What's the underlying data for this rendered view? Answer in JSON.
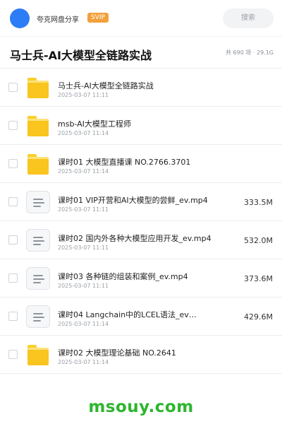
{
  "header": {
    "brand": "夸克网盘分享",
    "badge": "SVIP",
    "search_label": "搜索"
  },
  "folder": {
    "title": "马士兵-AI大模型全链路实战",
    "summary": "共 690 项 · 29.1G"
  },
  "files": [
    {
      "name": "马士兵-AI大模型全链路实战",
      "date": "2025-03-07 11:11",
      "type": "folder",
      "size": ""
    },
    {
      "name": "msb-AI大模型工程师",
      "date": "2025-03-07 11:14",
      "type": "folder",
      "size": ""
    },
    {
      "name": "课时01 大模型直播课 NO.2766.3701",
      "date": "2025-03-07 11:14",
      "type": "folder",
      "size": ""
    },
    {
      "name": "课时01 VIP开营和AI大模型的尝鲜_ev.mp4",
      "date": "2025-03-07 11:11",
      "type": "file",
      "size": "333.5M"
    },
    {
      "name": "课时02 国内外各种大模型应用开发_ev.mp4",
      "date": "2025-03-07 11:11",
      "type": "file",
      "size": "532.0M"
    },
    {
      "name": "课时03 各种链的组装和案例_ev.mp4",
      "date": "2025-03-07 11:11",
      "type": "file",
      "size": "373.6M"
    },
    {
      "name": "课时04 Langchain中的LCEL语法_ev…",
      "date": "2025-03-07 11:14",
      "type": "file",
      "size": "429.6M"
    },
    {
      "name": "课时02 大模型理论基础 NO.2641",
      "date": "2025-03-07 11:14",
      "type": "folder",
      "size": ""
    }
  ],
  "watermark": "msouy.com",
  "colors": {
    "avatar": "#2d7df6",
    "badge": "#f2a13b",
    "folder": "#f9c51e",
    "watermark": "#2cb52d"
  },
  "icons": {
    "folder": "folder-icon",
    "file": "video-file-icon"
  }
}
